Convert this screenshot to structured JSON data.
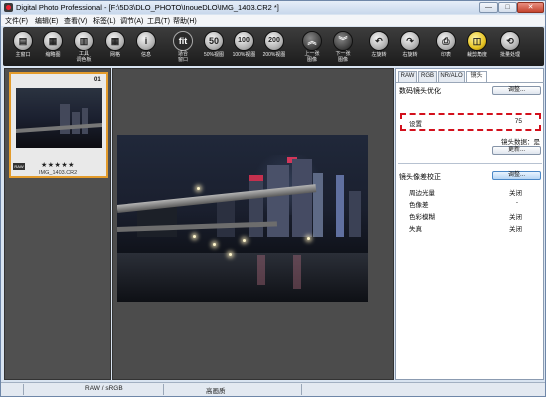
{
  "window": {
    "title": "Digital Photo Professional - [F:\\5D3\\DLO_PHOTO\\InoueDLO\\IMG_1403.CR2 *]",
    "min_label": "—",
    "max_label": "□",
    "close_label": "✕"
  },
  "menu": [
    "文件(F)",
    "编辑(E)",
    "查看(V)",
    "标签(L)",
    "调节(A)",
    "工具(T)",
    "帮助(H)"
  ],
  "toolbar": [
    {
      "label": "主窗口",
      "icon": "folder-icon",
      "glyph": "▤"
    },
    {
      "label": "缩略图",
      "icon": "thumbnails-icon",
      "glyph": "▦"
    },
    {
      "label": "工具\n调色板",
      "icon": "tool-palette-icon",
      "glyph": "▥"
    },
    {
      "label": "网格",
      "icon": "grid-icon",
      "glyph": "▦"
    },
    {
      "label": "信息",
      "icon": "info-icon",
      "glyph": "i"
    },
    {
      "label": "适合\n窗口",
      "icon": "fit-window-icon",
      "glyph": "fit"
    },
    {
      "label": "50%视图",
      "icon": "zoom-50-icon",
      "glyph": "50"
    },
    {
      "label": "100%视图",
      "icon": "zoom-100-icon",
      "glyph": "100"
    },
    {
      "label": "200%视图",
      "icon": "zoom-200-icon",
      "glyph": "200"
    },
    {
      "label": "上一张\n图像",
      "icon": "previous-image-icon",
      "glyph": "︽"
    },
    {
      "label": "下一张\n图像",
      "icon": "next-image-icon",
      "glyph": "︾"
    },
    {
      "label": "左旋转",
      "icon": "rotate-left-icon",
      "glyph": "↶"
    },
    {
      "label": "右旋转",
      "icon": "rotate-right-icon",
      "glyph": "↷"
    },
    {
      "label": "印表",
      "icon": "print-icon",
      "glyph": "⎙"
    },
    {
      "label": "裁剪角度",
      "icon": "crop-angle-icon",
      "glyph": "◫"
    },
    {
      "label": "批量处理",
      "icon": "batch-process-icon",
      "glyph": "⟲"
    }
  ],
  "thumbnail": {
    "filename": "IMG_1403.CR2",
    "rating": "★★★★★",
    "flag": "RAW",
    "badge": "01"
  },
  "panel": {
    "tabs": [
      "RAW",
      "RGB",
      "NR/ALO",
      "镜头"
    ],
    "active_tab": 3,
    "dlo_title": "数码镜头优化",
    "adjust_button": "调整...",
    "setting_label": "设置",
    "setting_value": "75",
    "lens_data_label": "镜头数据：是",
    "update_button": "更新...",
    "aberration_title": "镜头像差校正",
    "aberration_adjust_button": "调整...",
    "rows": [
      {
        "label": "周边光量",
        "value": "关闭"
      },
      {
        "label": "色像差",
        "value": "-"
      },
      {
        "label": "色彩模糊",
        "value": "关闭"
      },
      {
        "label": "失真",
        "value": "关闭"
      }
    ]
  },
  "status": {
    "color_space": "RAW / sRGB",
    "quality": "高画质"
  },
  "colors": {
    "highlight_dash": "#d3101c",
    "thumb_selection": "#e39b2b"
  }
}
